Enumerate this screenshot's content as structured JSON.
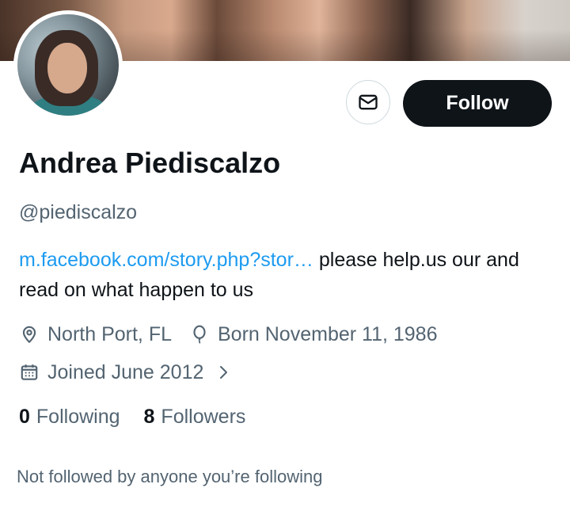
{
  "profile": {
    "name": "Andrea Piediscalzo",
    "handle": "@piediscalzo",
    "bio_link": "m.facebook.com/story.php?stor…",
    "bio_text": "please help.us our and read on what happen to us",
    "location": "North Port, FL",
    "birthday": "Born November 11, 1986",
    "joined": "Joined June 2012",
    "following_count": "0",
    "following_label": "Following",
    "followers_count": "8",
    "followers_label": "Followers",
    "followed_note": "Not followed by anyone you’re following"
  },
  "actions": {
    "follow_label": "Follow"
  },
  "icons": {
    "message": "envelope-icon",
    "location": "location-pin-icon",
    "birthday": "balloon-icon",
    "joined": "calendar-icon",
    "joined_more": "chevron-right-icon"
  },
  "colors": {
    "link": "#1d9bf0",
    "follow_bg": "#0f1419",
    "secondary_text": "#536471"
  }
}
